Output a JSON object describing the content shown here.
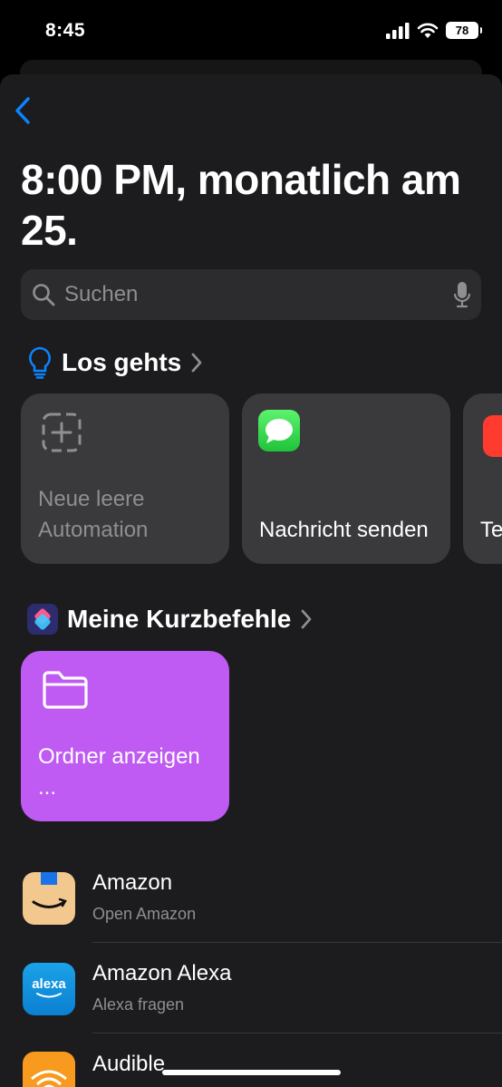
{
  "status_bar": {
    "time": "8:45",
    "battery": "78"
  },
  "title": "8:00 PM, monatlich am 25.",
  "search": {
    "placeholder": "Suchen"
  },
  "get_started": {
    "label": "Los gehts",
    "cards": [
      {
        "label": "Neue leere Automation",
        "icon": "add-automation-icon"
      },
      {
        "label": "Nachricht senden",
        "icon": "messages-icon"
      },
      {
        "label": "Te",
        "icon": "red-app-icon"
      }
    ]
  },
  "my_shortcuts": {
    "label": "Meine Kurzbefehle",
    "cards": [
      {
        "label": "Ordner anzeigen ...",
        "icon": "folder-icon",
        "color": "#bf5af2"
      }
    ]
  },
  "apps": [
    {
      "name": "Amazon",
      "subtitle": "Open Amazon",
      "icon": "amazon-icon"
    },
    {
      "name": "Amazon Alexa",
      "subtitle": "Alexa fragen",
      "icon": "alexa-icon",
      "icon_text": "alexa"
    },
    {
      "name": "Audible",
      "subtitle": "",
      "icon": "audible-icon"
    }
  ],
  "colors": {
    "accent": "#0a84ff",
    "sheet": "#1c1c1e",
    "card": "#3a3a3c",
    "shortcut": "#bf5af2"
  }
}
